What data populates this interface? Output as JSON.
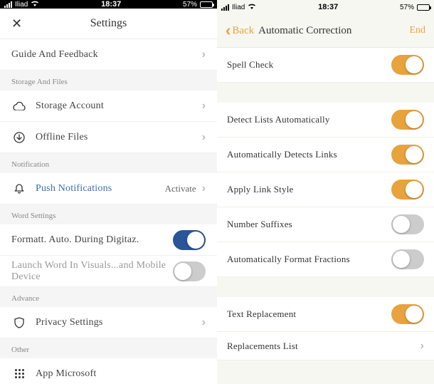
{
  "status": {
    "carrier": "Iliad",
    "time": "18:37",
    "battery_pct": "57%"
  },
  "left": {
    "title": "Settings",
    "guide_feedback": "Guide And Feedback",
    "section_storage": "Storage And Files",
    "storage_account": "Storage Account",
    "offline_files": "Offline Files",
    "section_notification": "Notification",
    "push_notifications": "Push Notifications",
    "push_value": "Activate",
    "section_word": "Word Settings",
    "format_auto": "Formatt. Auto. During Digitaz.",
    "launch_word": "Launch Word In Visuals...and Mobile Device",
    "section_advance": "Advance",
    "privacy": "Privacy Settings",
    "section_other": "Other",
    "app_microsoft": "App Microsoft"
  },
  "right": {
    "back": "Back",
    "title": "Automatic Correction",
    "action": "End",
    "spell_check": "Spell Check",
    "detect_lists": "Detect Lists Automatically",
    "detect_links": "Automatically Detects Links",
    "apply_link_style": "Apply Link Style",
    "number_suffixes": "Number Suffixes",
    "format_fractions": "Automatically Format Fractions",
    "text_replacement": "Text Replacement",
    "replacements_list": "Replacements List"
  }
}
